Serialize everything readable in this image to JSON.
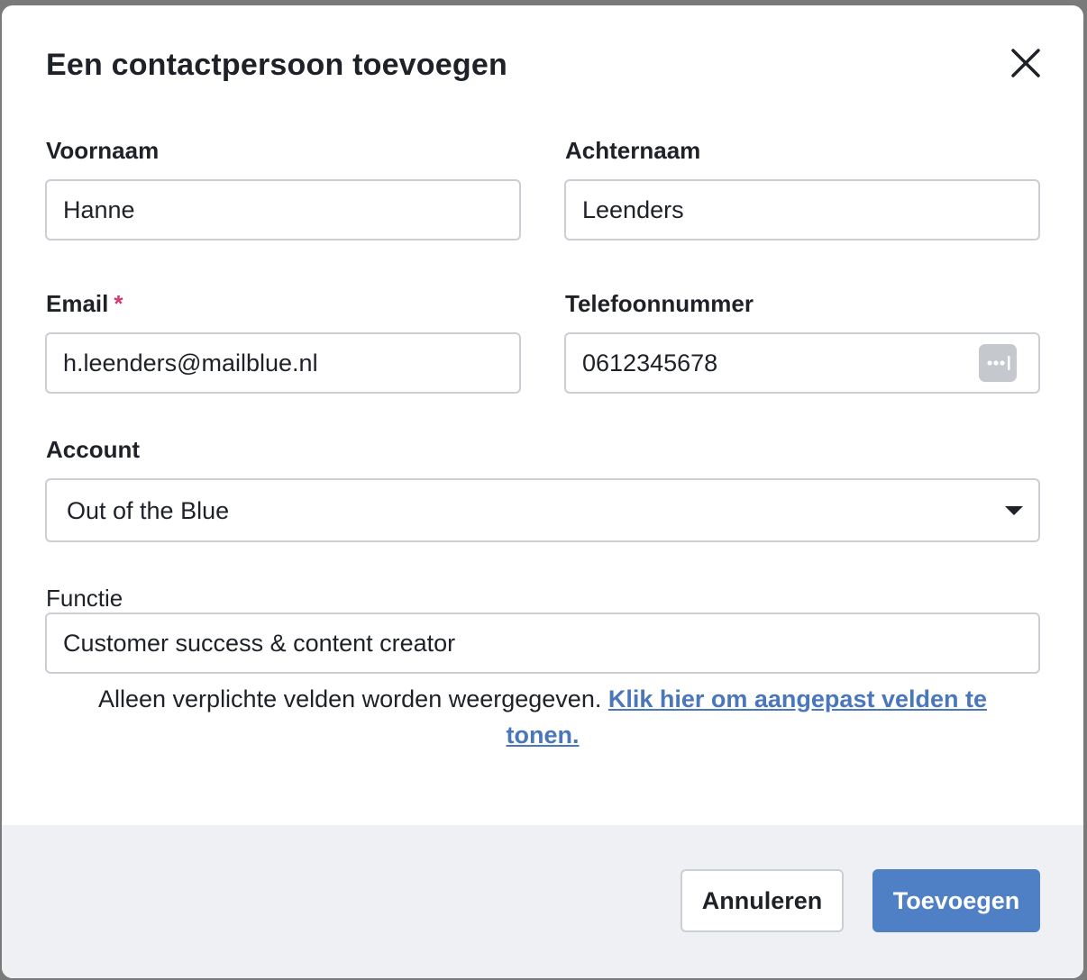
{
  "modal": {
    "title": "Een contactpersoon toevoegen"
  },
  "fields": {
    "first_name": {
      "label": "Voornaam",
      "value": "Hanne"
    },
    "last_name": {
      "label": "Achternaam",
      "value": "Leenders"
    },
    "email": {
      "label": "Email",
      "required_marker": "*",
      "value": "h.leenders@mailblue.nl"
    },
    "phone": {
      "label": "Telefoonnummer",
      "value": "0612345678"
    },
    "account": {
      "label": "Account",
      "value": "Out of the Blue"
    },
    "function": {
      "label": "Functie",
      "value": "Customer success & content creator"
    }
  },
  "hint": {
    "text": "Alleen verplichte velden worden weergegeven.",
    "link": "Klik hier om aangepast velden te tonen."
  },
  "footer": {
    "cancel_label": "Annuleren",
    "submit_label": "Toevoegen"
  },
  "colors": {
    "accent": "#4f7fc4",
    "link": "#4a77bb",
    "required": "#d9386b",
    "footer_bg": "#eff0f4"
  }
}
